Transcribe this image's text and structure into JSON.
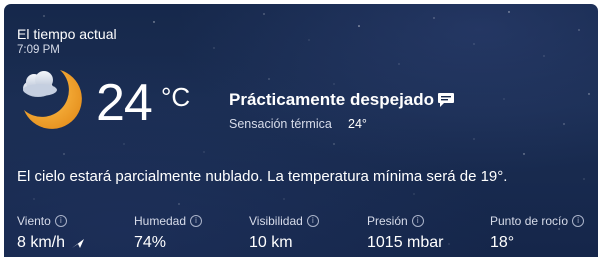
{
  "header": {
    "title": "El tiempo actual",
    "time": "7:09 PM"
  },
  "current": {
    "icon": "partly-cloudy-night-icon",
    "temperature": "24",
    "unit": "°C",
    "condition": "Prácticamente despejado",
    "feels_like_label": "Sensación térmica",
    "feels_like_value": "24°"
  },
  "summary": "El cielo estará parcialmente nublado. La temperatura mínima será de 19°.",
  "metrics": [
    {
      "label": "Viento",
      "value": "8 km/h",
      "icon": "wind-direction-arrow-icon"
    },
    {
      "label": "Humedad",
      "value": "74%"
    },
    {
      "label": "Visibilidad",
      "value": "10 km"
    },
    {
      "label": "Presión",
      "value": "1015 mbar"
    },
    {
      "label": "Punto de rocío",
      "value": "18°"
    }
  ],
  "colors": {
    "background": "#16284b",
    "moon": "#f2a531",
    "text_secondary": "#d7dcea"
  }
}
